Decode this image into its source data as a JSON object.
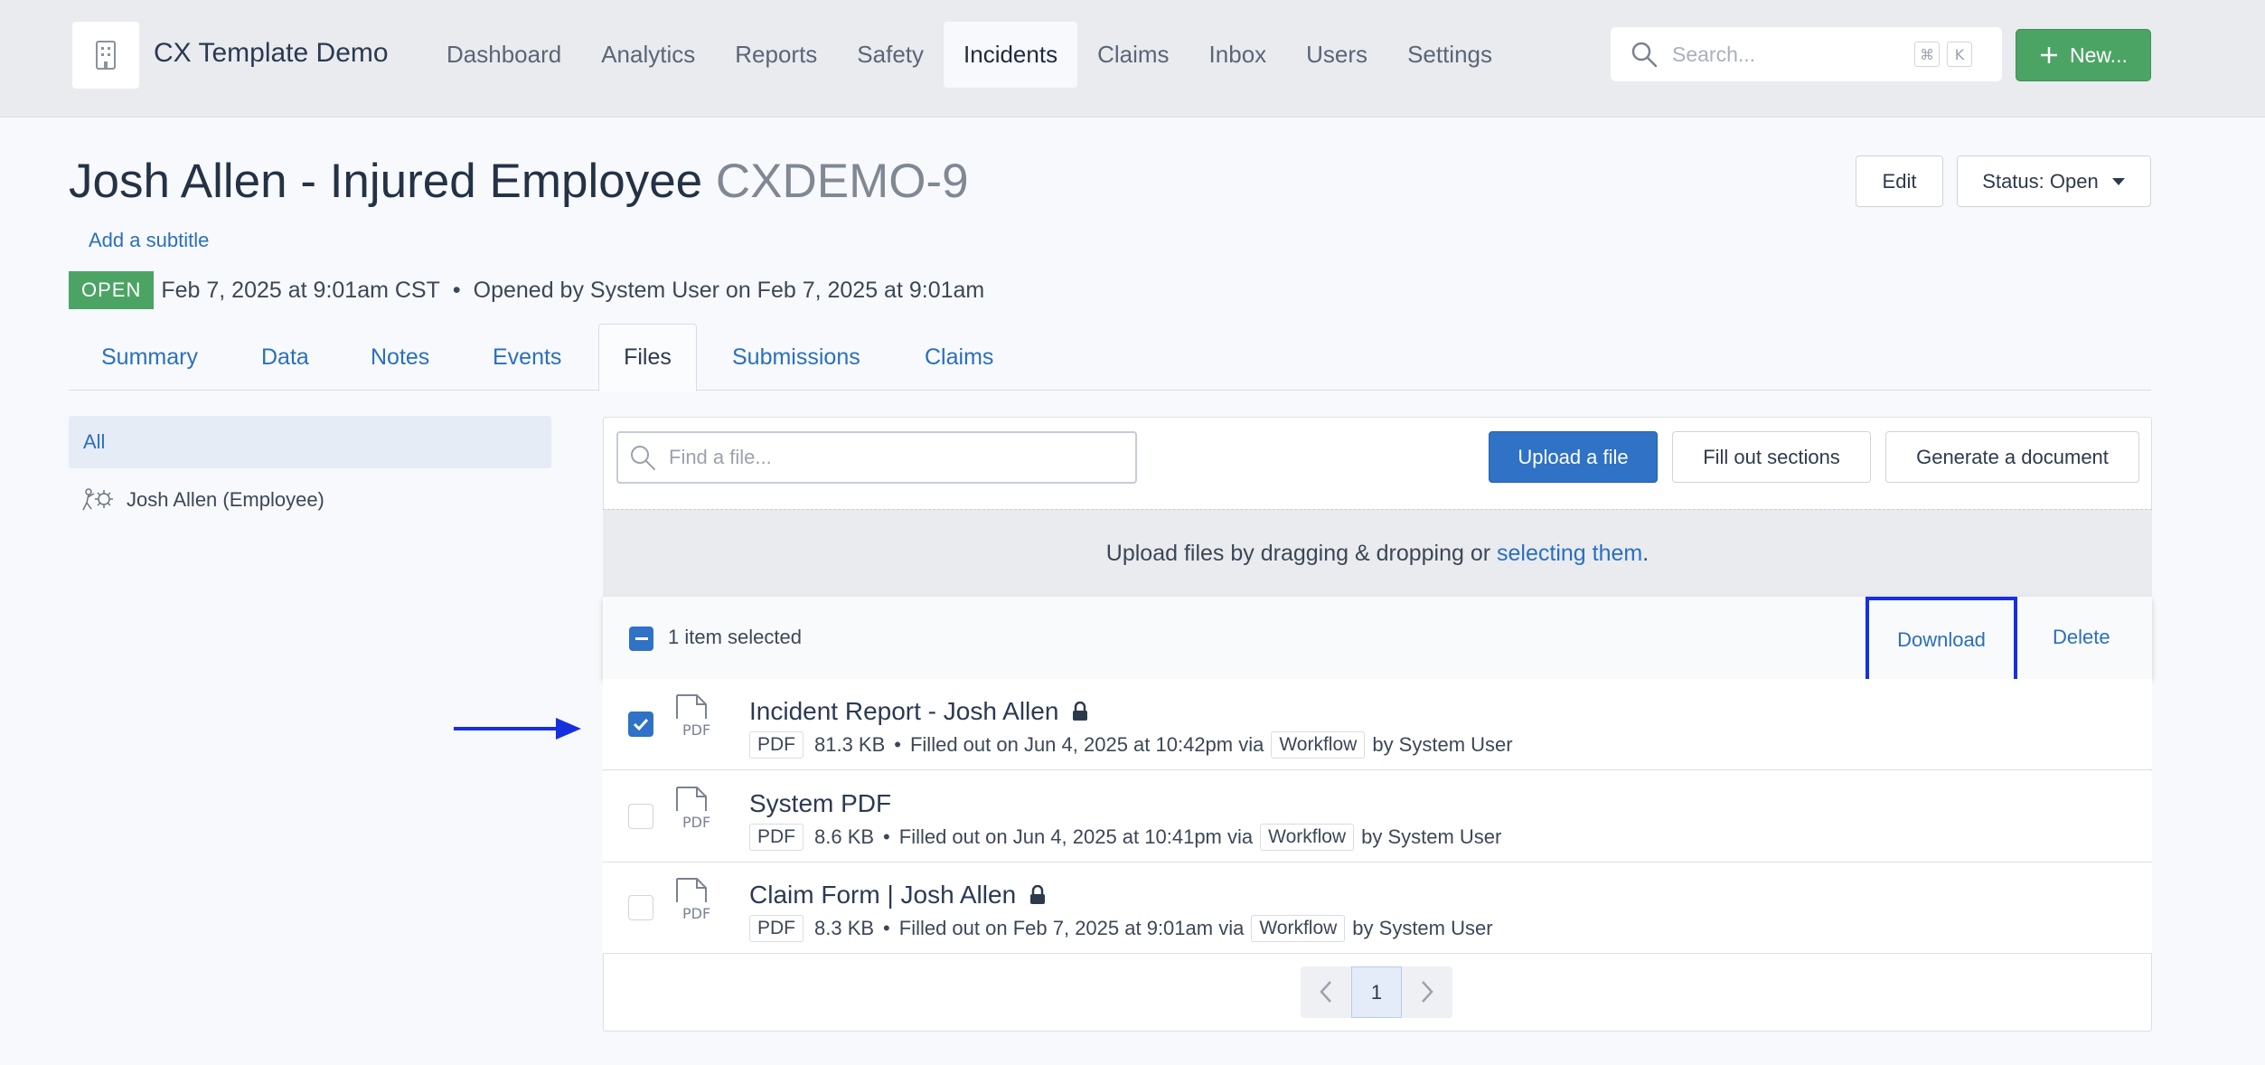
{
  "app": {
    "title": "CX Template Demo",
    "logo": "building-icon"
  },
  "nav": [
    {
      "label": "Dashboard"
    },
    {
      "label": "Analytics"
    },
    {
      "label": "Reports"
    },
    {
      "label": "Safety"
    },
    {
      "label": "Incidents",
      "active": true
    },
    {
      "label": "Claims"
    },
    {
      "label": "Inbox"
    },
    {
      "label": "Users"
    },
    {
      "label": "Settings"
    }
  ],
  "search": {
    "placeholder": "Search...",
    "shortcut_mod": "⌘",
    "shortcut_key": "K"
  },
  "new_button": {
    "label": "New..."
  },
  "header": {
    "title": "Josh Allen - Injured Employee",
    "code": "CXDEMO-9",
    "subtitle_link": "Add a subtitle",
    "status_badge": "OPEN",
    "date": "Feb 7, 2025 at 9:01am CST",
    "separator": "•",
    "opened_by": "Opened by System User on Feb 7, 2025 at 9:01am",
    "edit_label": "Edit",
    "status_label": "Status: Open"
  },
  "tabs": [
    {
      "label": "Summary"
    },
    {
      "label": "Data"
    },
    {
      "label": "Notes"
    },
    {
      "label": "Events"
    },
    {
      "label": "Files",
      "active": true
    },
    {
      "label": "Submissions"
    },
    {
      "label": "Claims"
    }
  ],
  "filters": {
    "all_label": "All",
    "person_label": "Josh Allen (Employee)"
  },
  "files_toolbar": {
    "find_placeholder": "Find a file...",
    "upload_label": "Upload a file",
    "fill_label": "Fill out sections",
    "generate_label": "Generate a document"
  },
  "dropzone": {
    "text": "Upload files by dragging & dropping or ",
    "link": "selecting them",
    "end": "."
  },
  "selection": {
    "count_label": "1 item selected",
    "download_label": "Download",
    "delete_label": "Delete"
  },
  "files": [
    {
      "name": "Incident Report - Josh Allen",
      "locked": true,
      "checked": true,
      "type": "PDF",
      "size": "81.3 KB",
      "filled": "Filled out on Jun 4, 2025 at 10:42pm via",
      "via": "Workflow",
      "by": "by System User"
    },
    {
      "name": "System PDF",
      "locked": false,
      "checked": false,
      "type": "PDF",
      "size": "8.6 KB",
      "filled": "Filled out on Jun 4, 2025 at 10:41pm via",
      "via": "Workflow",
      "by": "by System User"
    },
    {
      "name": "Claim Form | Josh Allen",
      "locked": true,
      "checked": false,
      "type": "PDF",
      "size": "8.3 KB",
      "filled": "Filled out on Feb 7, 2025 at 9:01am via",
      "via": "Workflow",
      "by": "by System User"
    }
  ],
  "file_icon_label": "PDF",
  "pagination": {
    "current": "1"
  },
  "colors": {
    "accent": "#2f72c6",
    "success": "#4ca464",
    "highlight": "#1630e0"
  }
}
